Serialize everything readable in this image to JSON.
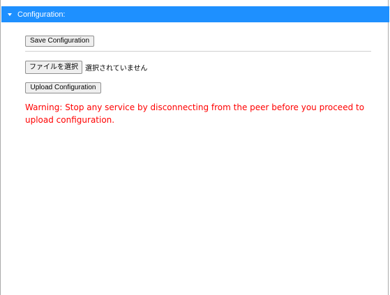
{
  "panel": {
    "title": "Configuration:",
    "toggle_icon": "caret-down-icon",
    "accent_color": "#1e90ff"
  },
  "save": {
    "label": "Save Configuration"
  },
  "file_input": {
    "button_label": "ファイルを選択",
    "status": "選択されていません"
  },
  "upload": {
    "label": "Upload Configuration"
  },
  "warning": {
    "text": "Warning: Stop any service by disconnecting from the peer before you proceed to upload configuration.",
    "color": "#ff0000"
  }
}
